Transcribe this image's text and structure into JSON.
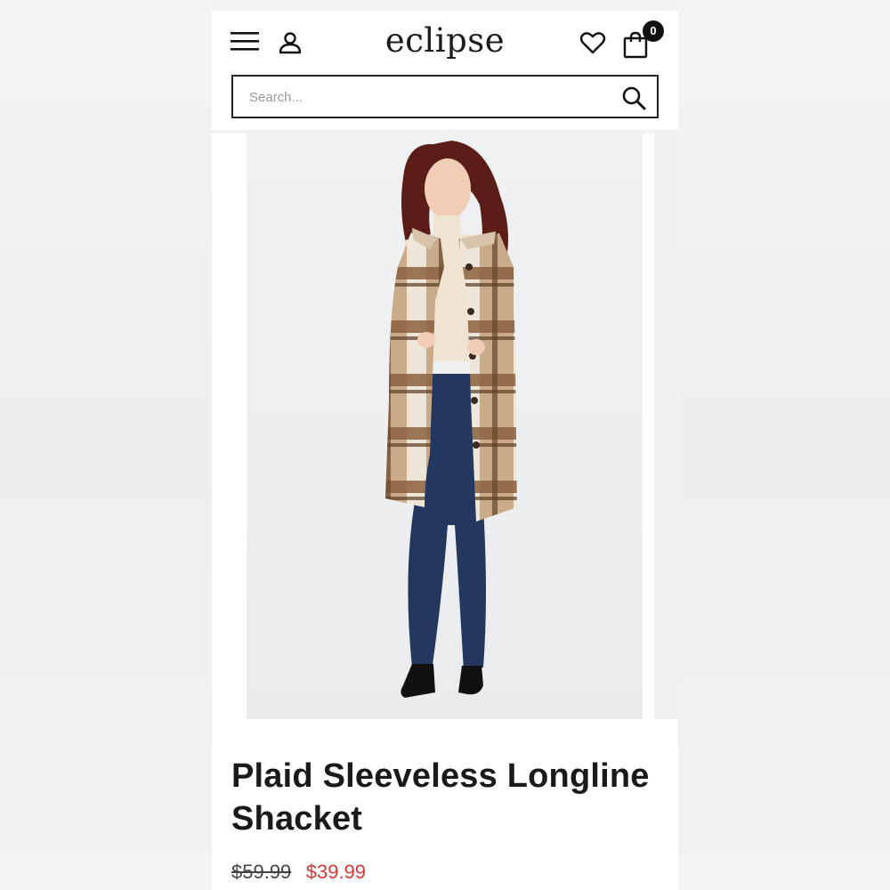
{
  "header": {
    "logo": "eclipse",
    "cart_count": "0"
  },
  "search": {
    "placeholder": "Search..."
  },
  "product": {
    "title_line1": "Plaid Sleeveless Longline",
    "title_line2": "Shacket",
    "price_original": "$59.99",
    "price_sale": "$39.99"
  },
  "colors": {
    "sale": "#d33a3a",
    "text": "#1a1a1a"
  },
  "icons": [
    "menu-icon",
    "user-icon",
    "heart-icon",
    "bag-icon",
    "search-icon"
  ]
}
